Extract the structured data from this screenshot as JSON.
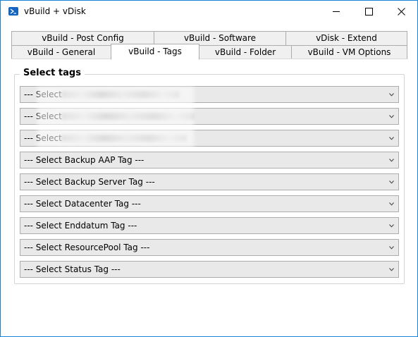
{
  "window": {
    "title": "vBuild + vDisk"
  },
  "tabs": {
    "row_top": [
      {
        "label": "vBuild - Post Config"
      },
      {
        "label": "vBuild - Software"
      },
      {
        "label": "vDisk - Extend"
      }
    ],
    "row_bottom": [
      {
        "label": "vBuild - General"
      },
      {
        "label": "vBuild - Tags",
        "selected": true
      },
      {
        "label": "vBuild - Folder"
      },
      {
        "label": "vBuild - VM Options"
      }
    ]
  },
  "group": {
    "title": "Select tags"
  },
  "combos": [
    {
      "text": "--- Select",
      "redacted": true
    },
    {
      "text": "--- Select",
      "redacted": true
    },
    {
      "text": "--- Select",
      "redacted": true
    },
    {
      "text": "--- Select Backup AAP Tag ---"
    },
    {
      "text": "--- Select Backup Server Tag ---"
    },
    {
      "text": "--- Select Datacenter Tag ---"
    },
    {
      "text": "--- Select Enddatum Tag ---"
    },
    {
      "text": "--- Select ResourcePool Tag ---"
    },
    {
      "text": "--- Select Status Tag ---"
    }
  ],
  "colors": {
    "window_border": "#1883d7",
    "combo_bg": "#e9e9e9",
    "combo_border": "#adadad"
  },
  "icons": {
    "app": "powershell-icon",
    "minimize": "minimize-icon",
    "maximize": "maximize-icon",
    "close": "close-icon",
    "dropdown": "chevron-down-icon"
  }
}
